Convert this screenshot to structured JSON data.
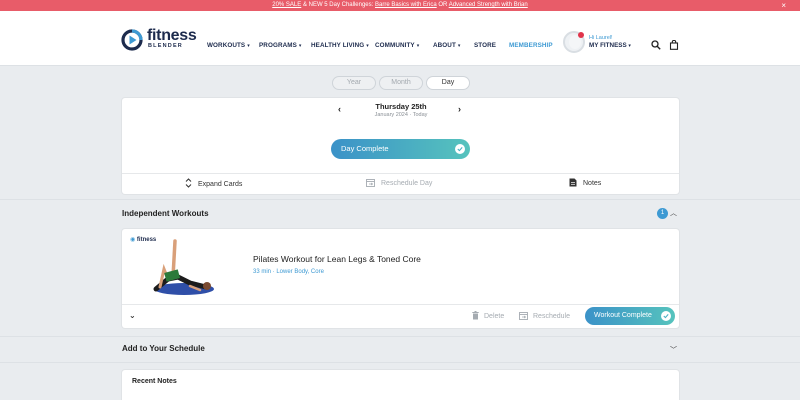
{
  "promo": {
    "prefix": "20% SALE",
    "middle": " & NEW 5 Day Challenges: ",
    "link1": "Barre Basics with Erica",
    "or": " OR ",
    "link2": "Advanced Strength with Brian",
    "close": "×"
  },
  "header": {
    "logo_word": "fitness",
    "logo_sub": "BLENDER",
    "nav": [
      {
        "label": "WORKOUTS",
        "caret": "▾"
      },
      {
        "label": "PROGRAMS",
        "caret": "▾"
      },
      {
        "label": "HEALTHY LIVING",
        "caret": "▾"
      },
      {
        "label": "COMMUNITY",
        "caret": "▾"
      },
      {
        "label": "ABOUT",
        "caret": "▾"
      },
      {
        "label": "STORE"
      },
      {
        "label": "MEMBERSHIP"
      }
    ],
    "greeting": "Hi Laurel!",
    "my_fitness": "MY FITNESS",
    "my_fitness_caret": "▾",
    "accent": "#3e9ad3"
  },
  "view_toggle": {
    "options": [
      "Year",
      "Month",
      "Day"
    ],
    "selected": "Day"
  },
  "date_card": {
    "prev": "‹",
    "next": "›",
    "day": "Thursday 25th",
    "sub": "January 2024 · Today",
    "day_complete": "Day Complete",
    "actions": {
      "expand": "Expand Cards",
      "reschedule": "Reschedule Day",
      "notes": "Notes"
    }
  },
  "independent": {
    "title": "Independent Workouts",
    "count": "1",
    "collapse": "︿",
    "workout": {
      "brand": "fitness",
      "title": "Pilates Workout for Lean Legs & Toned Core",
      "meta": "33 min · Lower Body, Core",
      "expand": "⌄",
      "delete": "Delete",
      "reschedule": "Reschedule",
      "complete": "Workout Complete"
    }
  },
  "add_schedule": {
    "title": "Add to Your Schedule",
    "expand": "﹀"
  },
  "recent_notes": {
    "title": "Recent Notes"
  },
  "colors": {
    "gradient_start": "#3b92c8",
    "gradient_end": "#56c3bd",
    "banner": "#e85c69",
    "navy": "#1d2b4d"
  }
}
